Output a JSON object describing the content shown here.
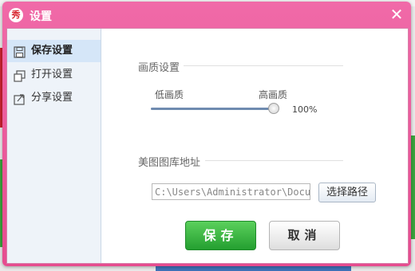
{
  "window": {
    "app_icon_text": "秀",
    "title": "设置",
    "close_symbol": "✕"
  },
  "sidebar": {
    "items": [
      {
        "label": "保存设置",
        "icon": "floppy-disk-icon",
        "active": true
      },
      {
        "label": "打开设置",
        "icon": "open-window-icon",
        "active": false
      },
      {
        "label": "分享设置",
        "icon": "share-icon",
        "active": false
      }
    ]
  },
  "quality": {
    "section_title": "画质设置",
    "low_label": "低画质",
    "high_label": "高画质",
    "value_text": "100%",
    "value_fraction": 1.0
  },
  "library": {
    "section_title": "美图图库地址",
    "path_value": "C:\\Users\\Administrator\\Documents",
    "browse_label": "选择路径"
  },
  "actions": {
    "save_label": "保存",
    "cancel_label": "取消"
  },
  "colors": {
    "titlebar": "#e64c8f",
    "save_green": "#2fb33a"
  }
}
